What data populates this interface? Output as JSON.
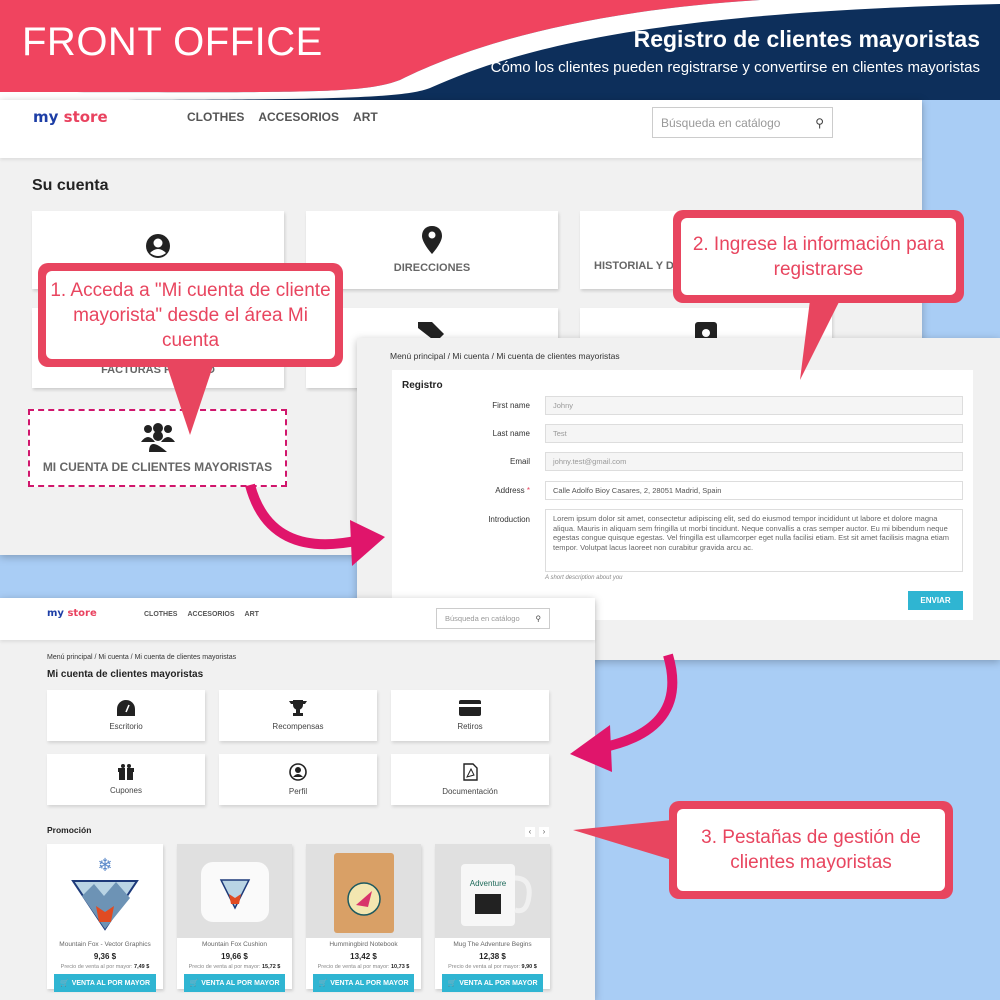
{
  "banner": {
    "left_title": "FRONT OFFICE",
    "title": "Registro de clientes mayoristas",
    "subtitle": "Cómo los clientes pueden registrarse y convertirse en clientes mayoristas",
    "colors": {
      "pink": "#f0445f",
      "navy": "#0d2f5b"
    }
  },
  "store1": {
    "logo": "my store",
    "logo_a": "my",
    "logo_b": "store",
    "nav": [
      "CLOTHES",
      "ACCESORIOS",
      "ART"
    ],
    "search_placeholder": "Búsqueda en catálogo",
    "page_title": "Su cuenta",
    "tiles": [
      {
        "label": "",
        "icon": "user-circle-icon"
      },
      {
        "label": "DIRECCIONES",
        "icon": "map-pin-icon"
      },
      {
        "label": "HISTORIAL Y D",
        "icon": "calendar-icon"
      },
      {
        "label": "FACTURAS POR ABO",
        "icon": "file-icon"
      },
      {
        "label": "",
        "icon": "tag-icon"
      },
      {
        "label": "",
        "icon": "camera-icon"
      }
    ],
    "wholesale_tile": {
      "label": "MI CUENTA DE CLIENTES MAYORISTAS",
      "icon": "users-icon"
    }
  },
  "callouts": {
    "c1": "1. Acceda a \"Mi cuenta de cliente mayorista\" desde el área Mi cuenta",
    "c2": "2. Ingrese la información para registrarse",
    "c3": "3. Pestañas de gestión de clientes mayoristas",
    "accent": "#e8455f",
    "arrow_color": "#e0156b"
  },
  "form": {
    "breadcrumb": [
      "Menú principal",
      "Mi cuenta",
      "Mi cuenta de clientes mayoristas"
    ],
    "title": "Registro",
    "fields": [
      {
        "label": "First name",
        "value": "Johny"
      },
      {
        "label": "Last name",
        "value": "Test"
      },
      {
        "label": "Email",
        "value": "johny.test@gmail.com"
      },
      {
        "label": "Address",
        "value": "Calle Adolfo Bioy Casares, 2, 28051 Madrid, Spain",
        "required": "*"
      }
    ],
    "intro_label": "Introduction",
    "intro_value": "Lorem ipsum dolor sit amet, consectetur adipiscing elit, sed do eiusmod tempor incididunt ut labore et dolore magna aliqua. Mauris in aliquam sem fringilla ut morbi tincidunt. Neque convallis a cras semper auctor. Eu mi bibendum neque egestas congue quisque egestas. Vel fringilla est ullamcorper eget nulla facilisi etiam. Est sit amet facilisis magna etiam tempor. Volutpat lacus laoreet non curabitur gravida arcu ac.",
    "intro_help": "A short description about you",
    "submit": "ENVIAR"
  },
  "store2": {
    "logo_a": "my",
    "logo_b": "store",
    "nav": [
      "CLOTHES",
      "ACCESORIOS",
      "ART"
    ],
    "search_placeholder": "Búsqueda en catálogo",
    "breadcrumb": [
      "Menú principal",
      "Mi cuenta",
      "Mi cuenta de clientes mayoristas"
    ],
    "page_title": "Mi cuenta de clientes mayoristas",
    "tiles": [
      {
        "label": "Escritorio",
        "icon": "dashboard-icon"
      },
      {
        "label": "Recompensas",
        "icon": "trophy-icon"
      },
      {
        "label": "Retiros",
        "icon": "credit-card-icon"
      },
      {
        "label": "Cupones",
        "icon": "gift-icon"
      },
      {
        "label": "Perfil",
        "icon": "user-circle-icon"
      },
      {
        "label": "Documentación",
        "icon": "pdf-icon"
      }
    ],
    "promo_title": "Promoción",
    "prev": "‹",
    "next": "›",
    "products": [
      {
        "name": "Mountain Fox - Vector Graphics",
        "price": "9,36 $",
        "wh_label": "Precio de venta al por mayor:",
        "wh_price": "7,49 $",
        "button": "VENTA AL POR MAYOR"
      },
      {
        "name": "Mountain Fox Cushion",
        "price": "19,66 $",
        "wh_label": "Precio de venta al por mayor:",
        "wh_price": "15,72 $",
        "button": "VENTA AL POR MAYOR"
      },
      {
        "name": "Hummingbird Notebook",
        "price": "13,42 $",
        "wh_label": "Precio de venta al por mayor:",
        "wh_price": "10,73 $",
        "button": "VENTA AL POR MAYOR"
      },
      {
        "name": "Mug The Adventure Begins",
        "price": "12,38 $",
        "wh_label": "Precio de venta al por mayor:",
        "wh_price": "9,90 $",
        "button": "VENTA AL POR MAYOR"
      }
    ]
  }
}
